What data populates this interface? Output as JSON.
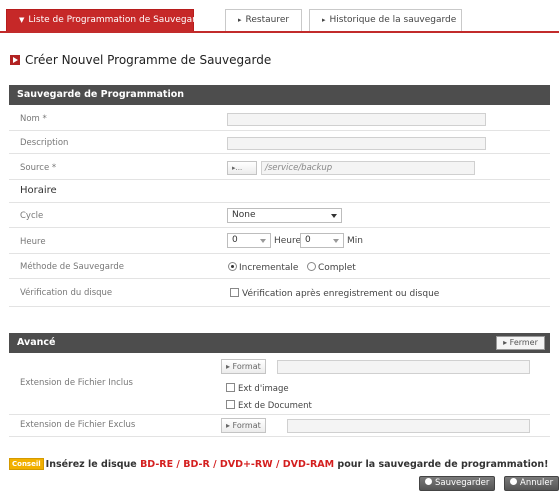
{
  "tabs": [
    {
      "label": "Liste de Programmation de Sauvegarde"
    },
    {
      "label": "Restaurer"
    },
    {
      "label": "Historique de la sauvegarde"
    }
  ],
  "heading": "Créer Nouvel Programme de Sauvegarde",
  "section_schedule": {
    "title": "Sauvegarde de Programmation",
    "nom_label": "Nom *",
    "description_label": "Description",
    "source_label": "Source *",
    "source_button": "▸...",
    "source_value": "/service/backup",
    "horaire_label": "Horaire",
    "cycle_label": "Cycle",
    "cycle_value": "None",
    "heure_label": "Heure",
    "heure_value": "0",
    "heure_unit": "Heure",
    "min_value": "0",
    "min_unit": "Min",
    "methode_label": "Méthode de Sauvegarde",
    "methode_options": [
      "Incrementale",
      "Complet"
    ],
    "methode_selected": "Incrementale",
    "verif_label": "Vérification du disque",
    "verif_option": "Vérification après enregistrement ou disque"
  },
  "section_advanced": {
    "title": "Avancé",
    "close_button": "▸ Fermer",
    "inclus_label": "Extension de Fichier Inclus",
    "exclus_label": "Extension de Fichier Exclus",
    "format_button": "▸ Format",
    "ext_image": "Ext d'image",
    "ext_document": "Ext de Document"
  },
  "tip": {
    "badge": "Conseil",
    "prefix": "Insérez le disque ",
    "media": "BD-RE / BD-R / DVD+-RW / DVD-RAM",
    "suffix": " pour la sauvegarde de programmation!"
  },
  "footer": {
    "save_label": "Sauvegarder",
    "cancel_label": "Annuler"
  },
  "colors": {
    "accent": "#c62828",
    "section_bar": "#4d4d4d",
    "tip_badge": "#f2b000"
  }
}
